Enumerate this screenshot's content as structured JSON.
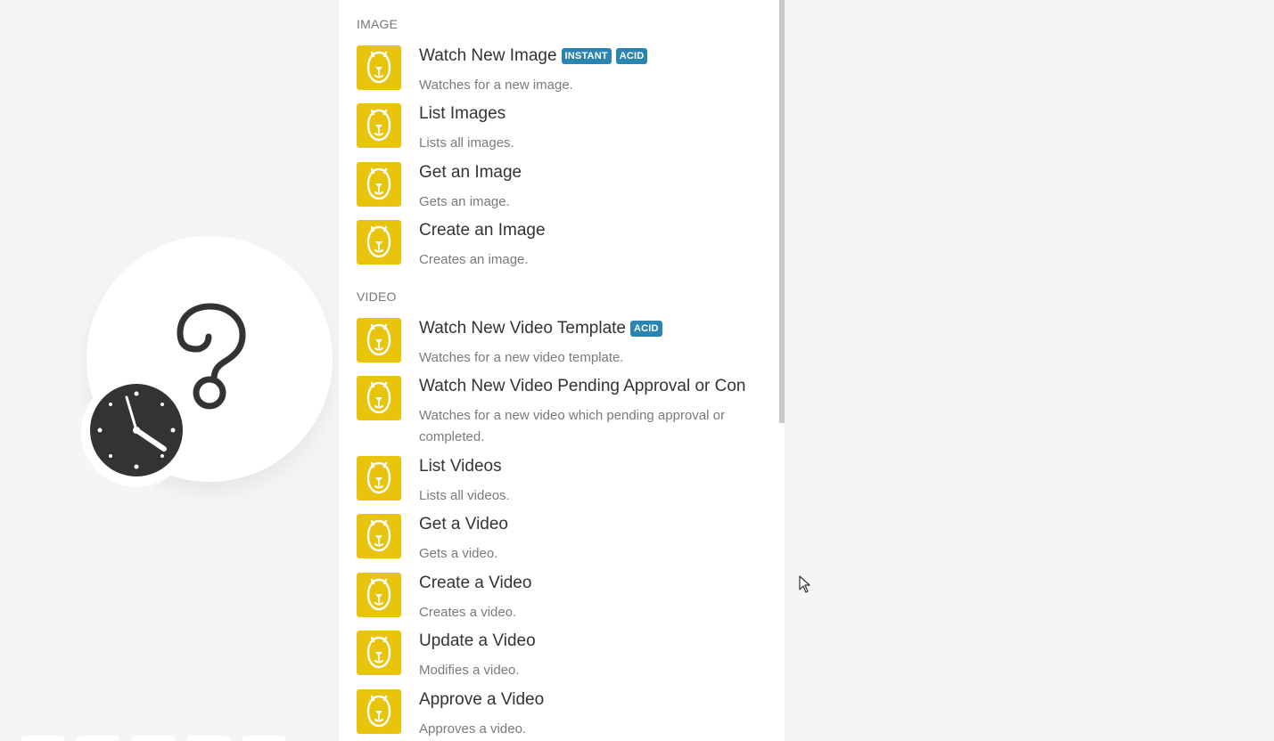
{
  "colors": {
    "canvas_bg": "#f5f5f5",
    "app_icon_bg": "#e8c40c",
    "badge_bg": "#2a86b0"
  },
  "sections": [
    {
      "title": "IMAGE",
      "items": [
        {
          "title": "Watch New Image",
          "desc": "Watches for a new image.",
          "badges": [
            "INSTANT",
            "ACID"
          ]
        },
        {
          "title": "List Images",
          "desc": "Lists all images.",
          "badges": []
        },
        {
          "title": "Get an Image",
          "desc": "Gets an image.",
          "badges": []
        },
        {
          "title": "Create an Image",
          "desc": "Creates an image.",
          "badges": []
        }
      ]
    },
    {
      "title": "VIDEO",
      "items": [
        {
          "title": "Watch New Video Template",
          "desc": "Watches for a new video template.",
          "badges": [
            "ACID"
          ]
        },
        {
          "title": "Watch New Video Pending Approval or Con",
          "desc": "Watches for a new video which pending approval or completed.",
          "badges": []
        },
        {
          "title": "List Videos",
          "desc": "Lists all videos.",
          "badges": []
        },
        {
          "title": "Get a Video",
          "desc": "Gets a video.",
          "badges": []
        },
        {
          "title": "Create a Video",
          "desc": "Creates a video.",
          "badges": []
        },
        {
          "title": "Update a Video",
          "desc": "Modifies a video.",
          "badges": []
        },
        {
          "title": "Approve a Video",
          "desc": "Approves a video.",
          "badges": []
        }
      ]
    }
  ],
  "icons": {
    "module_placeholder": "question-mark-icon",
    "schedule": "clock-icon",
    "app": "bear-app-icon",
    "pointer": "mouse-cursor-icon"
  }
}
